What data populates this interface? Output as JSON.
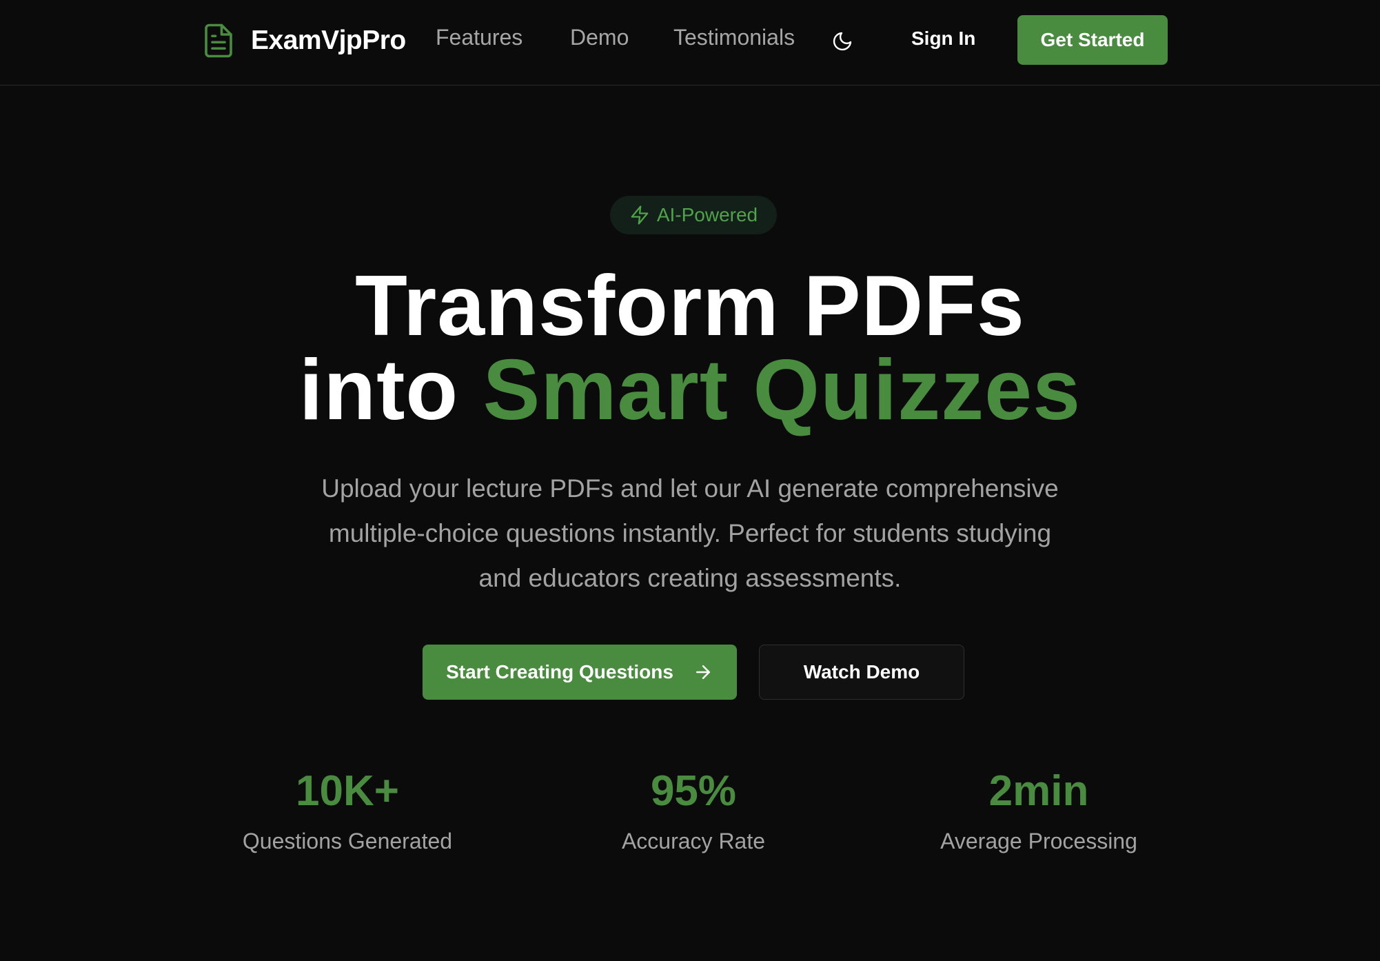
{
  "colors": {
    "background": "#0b0b0b",
    "accent": "#4a8c3f",
    "muted_text": "#a3a3a3",
    "badge_background": "#13201a"
  },
  "header": {
    "brand": {
      "icon": "document-icon",
      "name": "ExamVjpPro"
    },
    "nav": [
      {
        "label": "Features"
      },
      {
        "label": "Demo"
      },
      {
        "label": "Testimonials"
      }
    ],
    "theme_toggle_icon": "moon-icon",
    "sign_in_label": "Sign In",
    "get_started_label": "Get Started"
  },
  "hero": {
    "badge": {
      "icon": "lightning-icon",
      "label": "AI-Powered"
    },
    "headline": {
      "line1": "Transform PDFs",
      "line2_plain": "into",
      "line2_accent": "Smart Quizzes"
    },
    "subtitle": "Upload your lecture PDFs and let our AI generate comprehensive multiple-choice questions instantly. Perfect for students studying and educators creating assessments.",
    "primary_button": {
      "label": "Start Creating Questions",
      "icon": "arrow-right-icon"
    },
    "secondary_button": {
      "label": "Watch Demo"
    }
  },
  "stats": [
    {
      "value": "10K+",
      "label": "Questions Generated"
    },
    {
      "value": "95%",
      "label": "Accuracy Rate"
    },
    {
      "value": "2min",
      "label": "Average Processing"
    }
  ]
}
